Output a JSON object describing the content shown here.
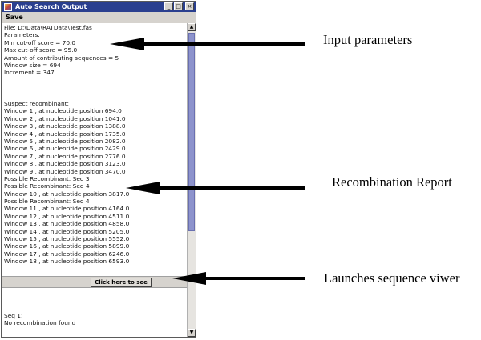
{
  "window": {
    "title": "Auto Search Output",
    "controls": [
      "_",
      "□",
      "×"
    ],
    "menu": {
      "save_label": "Save"
    }
  },
  "parameters": [
    "File: D:\\Data\\RATData\\Test.fas",
    "Parameters:",
    "Min cut-off score = 70.0",
    "Max cut-off score = 95.0",
    "Amount of contributing sequences = 5",
    "Window size = 694",
    "Increment = 347"
  ],
  "report": [
    "Suspect recombinant:",
    "Window 1 , at nucleotide position 694.0",
    "Window 2 , at nucleotide position 1041.0",
    "Window 3 , at nucleotide position 1388.0",
    "Window 4 , at nucleotide position 1735.0",
    "Window 5 , at nucleotide position 2082.0",
    "Window 6 , at nucleotide position 2429.0",
    "Window 7 , at nucleotide position 2776.0",
    "Window 8 , at nucleotide position 3123.0",
    "Window 9 , at nucleotide position 3470.0",
    "Possible Recombinant: Seq 3",
    "Possible Recombinant: Seq 4",
    "Window 10 , at nucleotide position 3817.0",
    "Possible Recombinant: Seq 4",
    "Window 11 , at nucleotide position 4164.0",
    "Window 12 , at nucleotide position 4511.0",
    "Window 13 , at nucleotide position 4858.0",
    "Window 14 , at nucleotide position 5205.0",
    "Window 15 , at nucleotide position 5552.0",
    "Window 16 , at nucleotide position 5899.0",
    "Window 17 , at nucleotide position 6246.0",
    "Window 18 , at nucleotide position 6593.0"
  ],
  "viewer_button": {
    "label": "Click here to see"
  },
  "sequence_info": [
    "Seq 1:",
    "No recombination found"
  ],
  "annotations": {
    "input": "Input parameters",
    "recombination": "Recombination Report",
    "viewer": "Launches sequence viwer"
  },
  "colors": {
    "titlebar": "#2a3f8f",
    "scroll_thumb": "#8d93cc",
    "window_bg": "#d6d3ce"
  }
}
